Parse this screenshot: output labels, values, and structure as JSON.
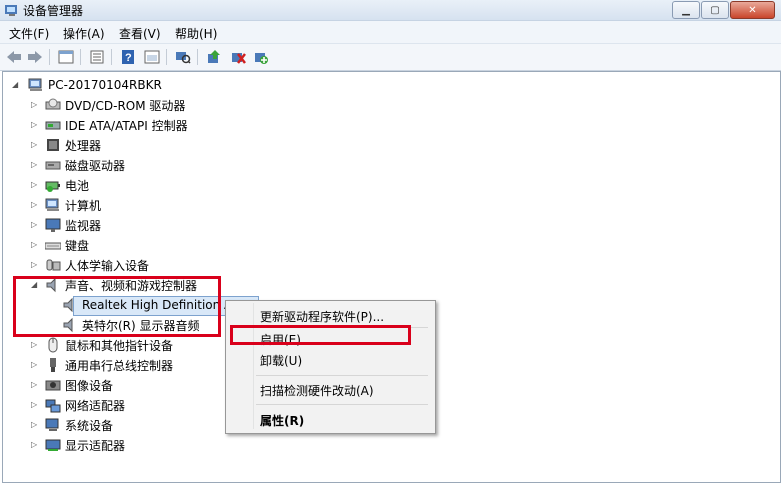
{
  "window": {
    "title": "设备管理器"
  },
  "menus": [
    "文件(F)",
    "操作(A)",
    "查看(V)",
    "帮助(H)"
  ],
  "toolbar": {
    "buttons": [
      "back-icon",
      "forward-icon",
      "sep",
      "view-icon",
      "sep",
      "properties-icon",
      "sep",
      "help-icon",
      "view2-icon",
      "sep",
      "scan-icon",
      "sep",
      "update-driver-icon",
      "disable-icon",
      "enable-icon"
    ]
  },
  "tree": {
    "root": "PC-20170104RBKR",
    "items": [
      {
        "label": "DVD/CD-ROM 驱动器",
        "icon": "dvd-drive-icon"
      },
      {
        "label": "IDE ATA/ATAPI 控制器",
        "icon": "ide-controller-icon"
      },
      {
        "label": "处理器",
        "icon": "processor-icon"
      },
      {
        "label": "磁盘驱动器",
        "icon": "disk-drive-icon"
      },
      {
        "label": "电池",
        "icon": "battery-icon"
      },
      {
        "label": "计算机",
        "icon": "computer-icon"
      },
      {
        "label": "监视器",
        "icon": "monitor-icon"
      },
      {
        "label": "键盘",
        "icon": "keyboard-icon"
      },
      {
        "label": "人体学输入设备",
        "icon": "hid-icon"
      },
      {
        "label": "声音、视频和游戏控制器",
        "icon": "speaker-icon",
        "expanded": true
      },
      {
        "label": "Realtek High Definition A",
        "icon": "speaker-icon",
        "child": true
      },
      {
        "label": "英特尔(R) 显示器音频",
        "icon": "speaker-icon",
        "child": true
      },
      {
        "label": "鼠标和其他指针设备",
        "icon": "mouse-icon"
      },
      {
        "label": "通用串行总线控制器",
        "icon": "usb-icon"
      },
      {
        "label": "图像设备",
        "icon": "camera-icon"
      },
      {
        "label": "网络适配器",
        "icon": "network-icon"
      },
      {
        "label": "系统设备",
        "icon": "system-device-icon"
      },
      {
        "label": "显示适配器",
        "icon": "display-adapter-icon"
      }
    ]
  },
  "context_menu": {
    "items": [
      {
        "label": "更新驱动程序软件(P)..."
      },
      {
        "label": "启用(E)"
      },
      {
        "label": "卸载(U)"
      },
      {
        "label": "扫描检测硬件改动(A)"
      },
      {
        "label": "属性(R)",
        "bold": true
      }
    ]
  },
  "colors": {
    "highlight_box": "#d9001b",
    "selection": "#d9e8f8"
  }
}
